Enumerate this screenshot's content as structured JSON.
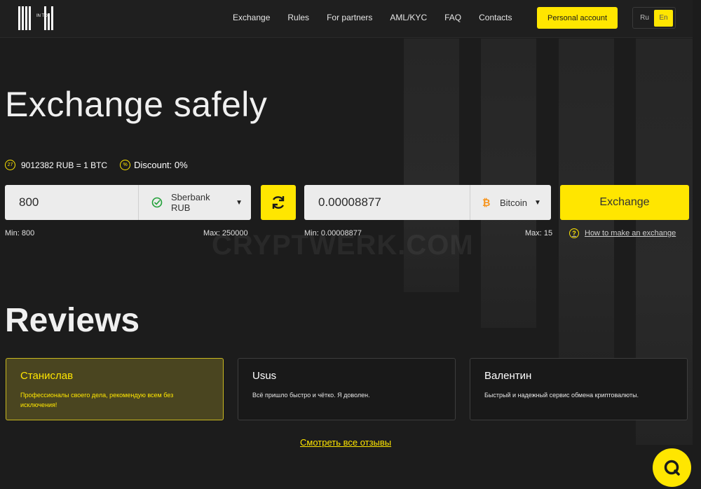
{
  "header": {
    "logo_text": "IN TO",
    "nav": [
      "Exchange",
      "Rules",
      "For partners",
      "AML/KYC",
      "FAQ",
      "Contacts"
    ],
    "account_button": "Personal account",
    "lang": {
      "ru": "Ru",
      "en": "En",
      "active": "En"
    }
  },
  "hero": {
    "title": "Exchange safely",
    "rate_badge": "27",
    "rate": "9012382 RUB = 1 BTC",
    "discount": "Discount: 0%"
  },
  "exchange": {
    "give_amount": "800",
    "give_currency": "Sberbank RUB",
    "get_amount": "0.00008877",
    "get_currency": "Bitcoin",
    "button": "Exchange",
    "give_min": "Min: 800",
    "give_max": "Max: 250000",
    "get_min": "Min: 0.00008877",
    "get_max": "Max: 15",
    "howto": "How to make an exchange"
  },
  "watermark": "CRYPTWERK.COM",
  "reviews": {
    "title": "Reviews",
    "items": [
      {
        "name": "Станислав",
        "text": "Профессионалы своего дела, рекомендую всем без исключения!"
      },
      {
        "name": "Usus",
        "text": "Всё пришло быстро и чётко. Я доволен."
      },
      {
        "name": "Валентин",
        "text": "Быстрый и надежный сервис обмена криптовалюты."
      }
    ],
    "all_link": "Смотреть все отзывы"
  },
  "colors": {
    "accent": "#ffe600",
    "background": "#1c1c1c",
    "input": "#ececec",
    "sberbank": "#21a038",
    "bitcoin": "#f7931a"
  },
  "icons": {
    "swap": "refresh-icon",
    "chat": "chat-icon",
    "help": "question-icon",
    "discount": "percent-icon"
  }
}
